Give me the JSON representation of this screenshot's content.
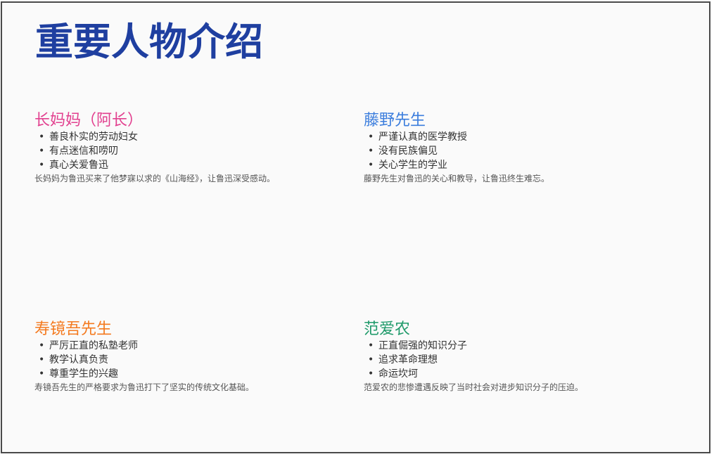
{
  "slide": {
    "title": "重要人物介绍",
    "people": [
      {
        "name": "长妈妈（阿长）",
        "color": "#e2408f",
        "traits": [
          "善良朴实的劳动妇女",
          "有点迷信和唠叨",
          "真心关爱鲁迅"
        ],
        "description": "长妈妈为鲁迅买来了他梦寐以求的《山海经》，让鲁迅深受感动。"
      },
      {
        "name": "藤野先生",
        "color": "#3b7ddd",
        "traits": [
          "严谨认真的医学教授",
          "没有民族偏见",
          "关心学生的学业"
        ],
        "description": "藤野先生对鲁迅的关心和教导，让鲁迅终生难忘。"
      },
      {
        "name": "寿镜吾先生",
        "color": "#f47a1f",
        "traits": [
          "严厉正直的私塾老师",
          "教学认真负责",
          "尊重学生的兴趣"
        ],
        "description": "寿镜吾先生的严格要求为鲁迅打下了坚实的传统文化基础。"
      },
      {
        "name": "范爱农",
        "color": "#1f9a6a",
        "traits": [
          "正直倔强的知识分子",
          "追求革命理想",
          "命运坎坷"
        ],
        "description": "范爱农的悲惨遭遇反映了当时社会对进步知识分子的压迫。"
      }
    ]
  }
}
